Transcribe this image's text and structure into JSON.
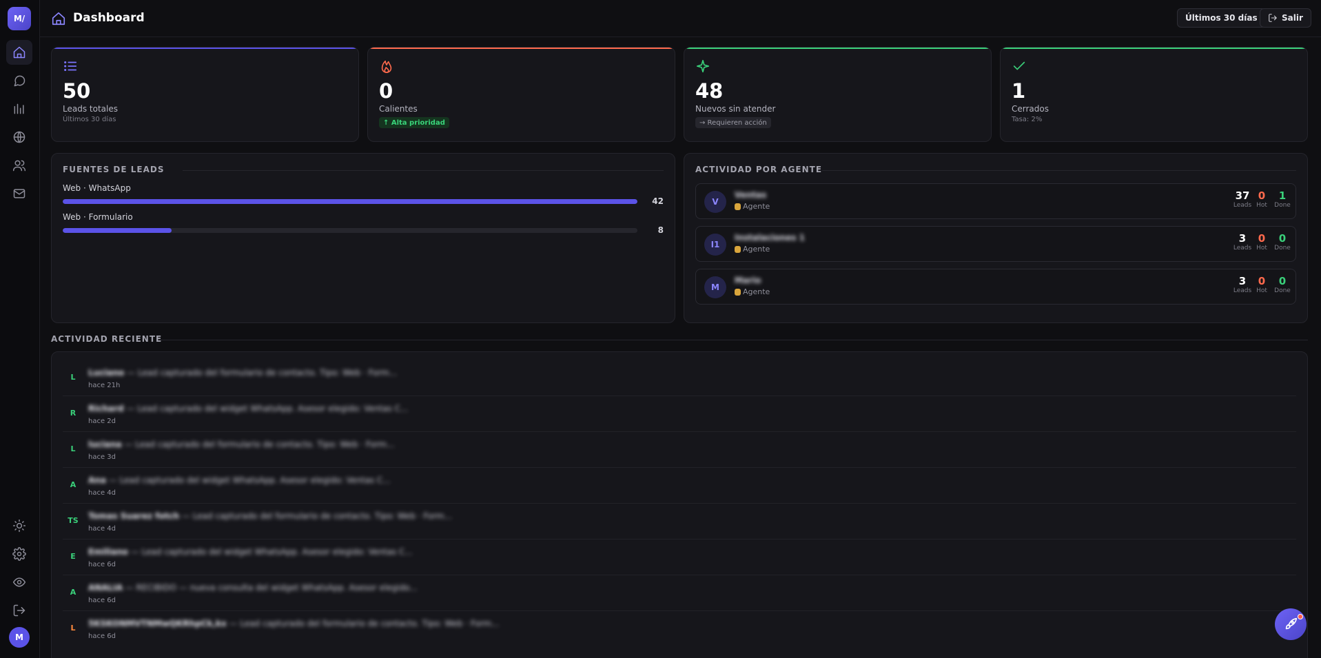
{
  "sidebar": {
    "logo": "M/",
    "avatar": "M"
  },
  "header": {
    "title": "Dashboard",
    "period_button": "Últimos 30 días",
    "logout_button": "Salir"
  },
  "stats": [
    {
      "value": "50",
      "label": "Leads totales",
      "sub": "Últimos 30 días",
      "accent": "#5b53e8"
    },
    {
      "value": "0",
      "label": "Calientes",
      "pill": "↑ Alta prioridad",
      "accent": "#ff6a4d"
    },
    {
      "value": "48",
      "label": "Nuevos sin atender",
      "pill": "→ Requieren acción",
      "accent": "#3ad07a"
    },
    {
      "value": "1",
      "label": "Cerrados",
      "sub": "Tasa: 2%",
      "accent": "#3ad07a"
    }
  ],
  "sources": {
    "title": "FUENTES DE LEADS",
    "items": [
      {
        "name": "Web · WhatsApp",
        "count": "42",
        "share": 1.0
      },
      {
        "name": "Web · Formulario",
        "count": "8",
        "share": 0.19
      }
    ]
  },
  "agents": {
    "title": "ACTIVIDAD POR AGENTE",
    "items": [
      {
        "initials": "V",
        "name": "Ventas",
        "role": "Agente",
        "leads": "37",
        "hot": "0",
        "done": "1"
      },
      {
        "initials": "I1",
        "name": "Instalaciones 1",
        "role": "Agente",
        "leads": "3",
        "hot": "0",
        "done": "0"
      },
      {
        "initials": "M",
        "name": "Mario",
        "role": "Agente",
        "leads": "3",
        "hot": "0",
        "done": "0"
      }
    ],
    "labels": {
      "leads": "Leads",
      "hot": "Hot",
      "done": "Done"
    }
  },
  "recent": {
    "title": "ACTIVIDAD RECIENTE",
    "items": [
      {
        "initials": "L",
        "name": "Luciano",
        "text": " — Lead capturado del formulario de contacto. Tipo: Web · Form...",
        "time": "hace 21h",
        "color": "#3ad07a"
      },
      {
        "initials": "R",
        "name": "Richard",
        "text": " — Lead capturado del widget WhatsApp. Asesor elegido: Ventas C...",
        "time": "hace 2d",
        "color": "#3ad07a"
      },
      {
        "initials": "L",
        "name": "luciana",
        "text": " — Lead capturado del formulario de contacto. Tipo: Web · Form...",
        "time": "hace 3d",
        "color": "#3ad07a"
      },
      {
        "initials": "A",
        "name": "Ana",
        "text": " — Lead capturado del widget WhatsApp. Asesor elegido: Ventas C...",
        "time": "hace 4d",
        "color": "#3ad07a"
      },
      {
        "initials": "TS",
        "name": "Tomas Suarez fotch",
        "text": " — Lead capturado del formulario de contacto. Tipo: Web · Form...",
        "time": "hace 4d",
        "color": "#3ad07a"
      },
      {
        "initials": "E",
        "name": "Emiliano",
        "text": " — Lead capturado del widget WhatsApp. Asesor elegido: Ventas C...",
        "time": "hace 6d",
        "color": "#3ad07a"
      },
      {
        "initials": "A",
        "name": "ANALIA",
        "text": " — RECIBIDO — nueva consulta del widget WhatsApp. Asesor elegido...",
        "time": "hace 6d",
        "color": "#3ad07a"
      },
      {
        "initials": "L",
        "name": "5KSKONMVTNMwQKRhpCk,kx",
        "text": " — Lead capturado del formulario de contacto. Tipo: Web · Form...",
        "time": "hace 6d",
        "color": "#ff8a3d"
      }
    ]
  }
}
